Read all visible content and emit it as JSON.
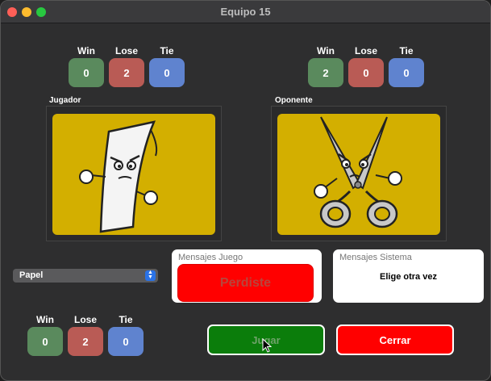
{
  "window": {
    "title": "Equipo 15"
  },
  "score_labels": {
    "win": "Win",
    "lose": "Lose",
    "tie": "Tie"
  },
  "player_score": {
    "win": "0",
    "lose": "2",
    "tie": "0"
  },
  "opponent_score": {
    "win": "2",
    "lose": "0",
    "tie": "0"
  },
  "bottom_score": {
    "win": "0",
    "lose": "2",
    "tie": "0"
  },
  "jugador": {
    "label": "Jugador",
    "choice_icon": "paper-character-icon"
  },
  "oponente": {
    "label": "Oponente",
    "choice_icon": "scissors-character-icon"
  },
  "dropdown": {
    "selected": "Papel"
  },
  "mensajes_juego": {
    "header": "Mensajes Juego",
    "result": "Perdiste"
  },
  "mensajes_sistema": {
    "header": "Mensajes Sistema",
    "text": "Elige otra vez"
  },
  "buttons": {
    "jugar": "Jugar",
    "cerrar": "Cerrar"
  },
  "colors": {
    "win": "#5a8a5d",
    "lose": "#b95b55",
    "tie": "#5f83cf",
    "art_bg": "#d3af00",
    "result_red": "#ff0000",
    "jugar_green": "#0b7d0b"
  }
}
